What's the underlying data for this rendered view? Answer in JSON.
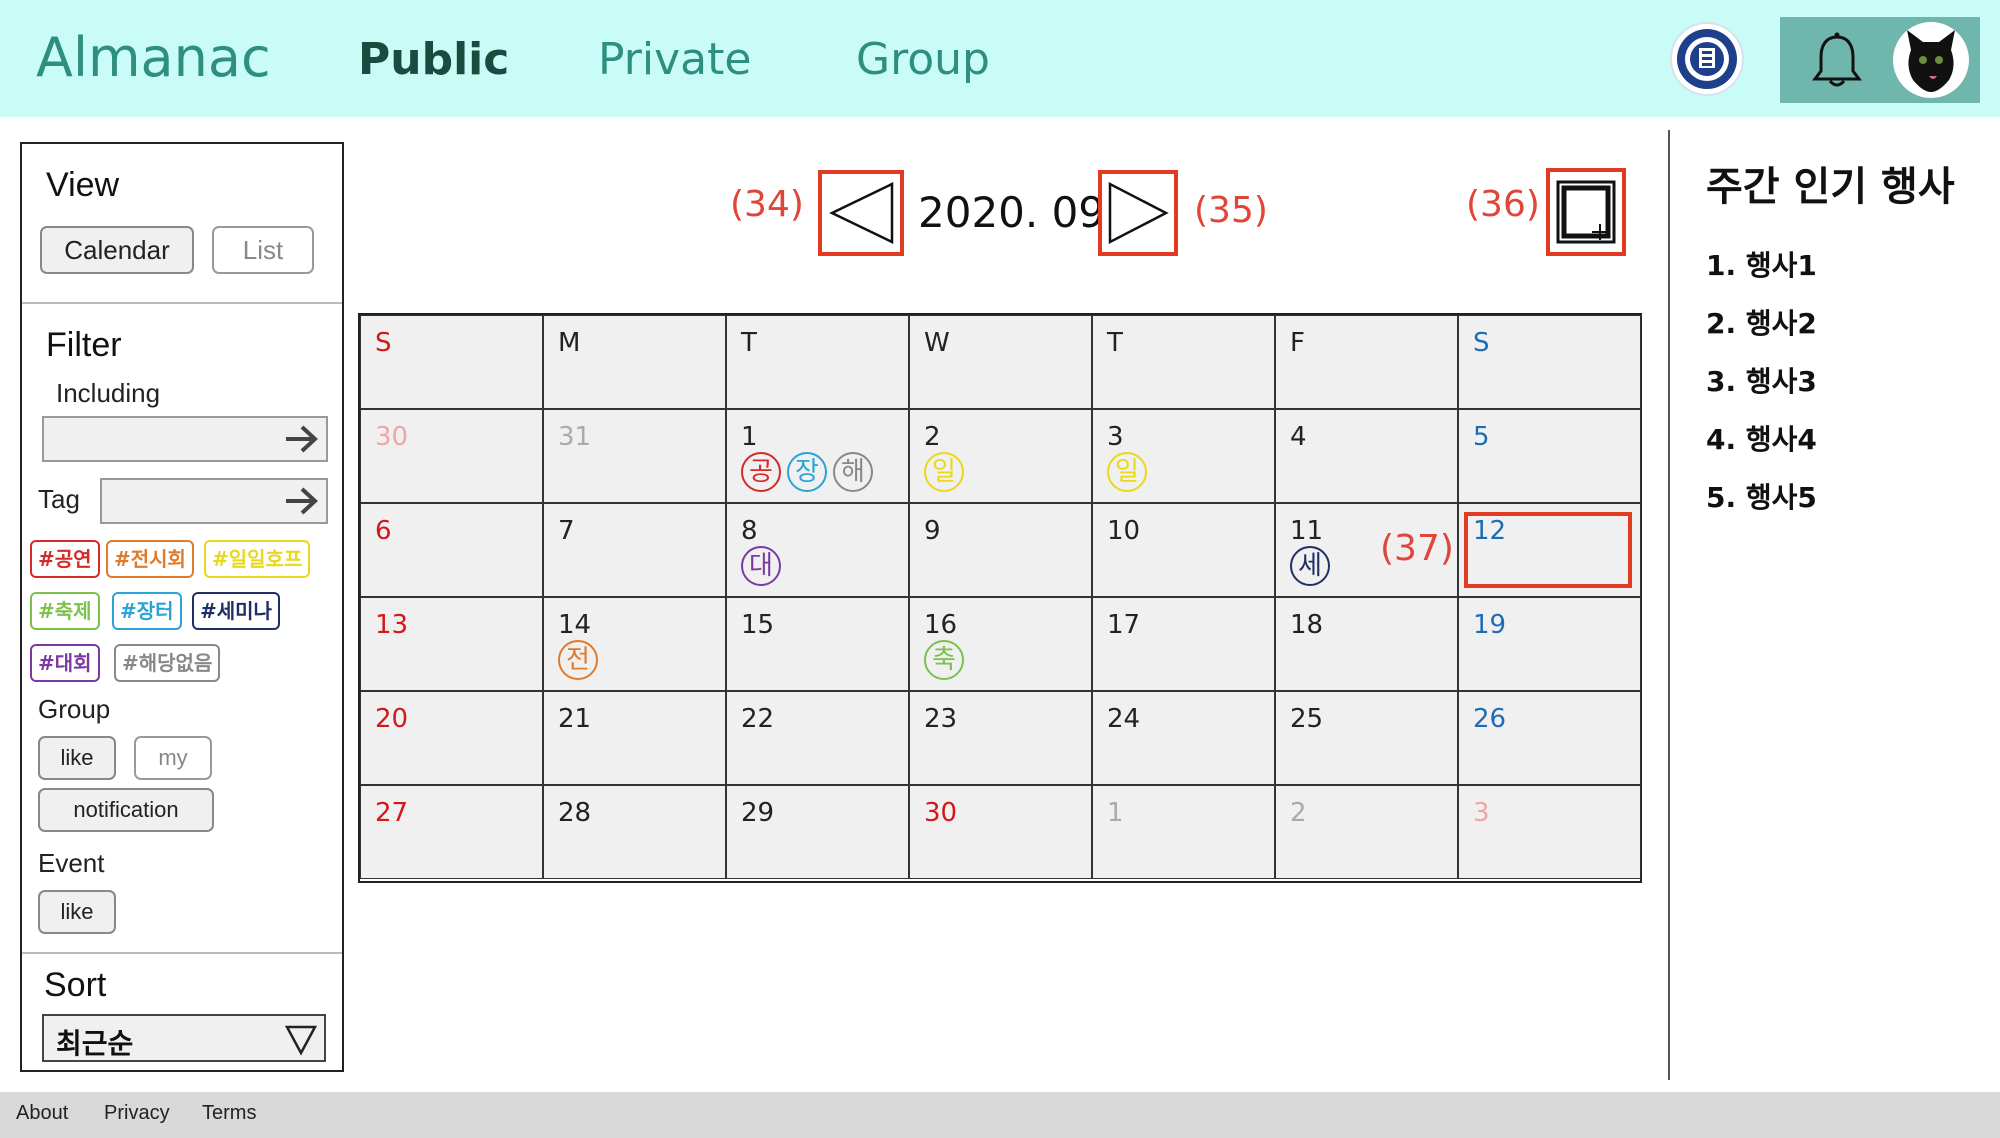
{
  "header": {
    "logo": "Almanac",
    "nav": [
      "Public",
      "Private",
      "Group"
    ],
    "active_nav": "Public"
  },
  "view": {
    "title": "View",
    "calendar_label": "Calendar",
    "list_label": "List"
  },
  "filter": {
    "title": "Filter",
    "including_label": "Including",
    "including_value": "",
    "tag_label": "Tag",
    "tag_value": "",
    "tags": [
      {
        "label": "#공연",
        "color": "#d42a2a"
      },
      {
        "label": "#전시회",
        "color": "#e07b2c"
      },
      {
        "label": "#일일호프",
        "color": "#e9d81c"
      },
      {
        "label": "#축제",
        "color": "#7dc04a"
      },
      {
        "label": "#장터",
        "color": "#2aa3d6"
      },
      {
        "label": "#세미나",
        "color": "#1f2f66"
      },
      {
        "label": "#대회",
        "color": "#7a3aa3"
      },
      {
        "label": "#해당없음",
        "color": "#888888"
      }
    ],
    "group_label": "Group",
    "group_like": "like",
    "group_my": "my",
    "group_notification": "notification",
    "event_label": "Event",
    "event_like": "like"
  },
  "sort": {
    "title": "Sort",
    "selected": "최근순"
  },
  "calendar": {
    "month_label": "2020. 09.",
    "annot_prev": "(34)",
    "annot_next": "(35)",
    "annot_add": "(36)",
    "annot_cell": "(37)",
    "weekdays": [
      "S",
      "M",
      "T",
      "W",
      "T",
      "F",
      "S"
    ],
    "weeks": [
      [
        {
          "d": "30",
          "dim": true,
          "badges": []
        },
        {
          "d": "31",
          "dim": true,
          "badges": []
        },
        {
          "d": "1",
          "badges": [
            {
              "t": "공",
              "c": "#d42a2a"
            },
            {
              "t": "장",
              "c": "#2aa3d6"
            },
            {
              "t": "해",
              "c": "#888888"
            }
          ]
        },
        {
          "d": "2",
          "badges": [
            {
              "t": "일",
              "c": "#e9d81c"
            }
          ]
        },
        {
          "d": "3",
          "badges": [
            {
              "t": "일",
              "c": "#e9d81c"
            }
          ]
        },
        {
          "d": "4",
          "badges": []
        },
        {
          "d": "5",
          "badges": []
        }
      ],
      [
        {
          "d": "6",
          "badges": []
        },
        {
          "d": "7",
          "badges": []
        },
        {
          "d": "8",
          "badges": [
            {
              "t": "대",
              "c": "#7a3aa3"
            }
          ]
        },
        {
          "d": "9",
          "badges": []
        },
        {
          "d": "10",
          "badges": []
        },
        {
          "d": "11",
          "badges": [
            {
              "t": "세",
              "c": "#1f2f66"
            }
          ]
        },
        {
          "d": "12",
          "badges": []
        }
      ],
      [
        {
          "d": "13",
          "badges": []
        },
        {
          "d": "14",
          "badges": [
            {
              "t": "전",
              "c": "#e07b2c"
            }
          ]
        },
        {
          "d": "15",
          "badges": []
        },
        {
          "d": "16",
          "badges": [
            {
              "t": "축",
              "c": "#7dc04a"
            }
          ]
        },
        {
          "d": "17",
          "badges": []
        },
        {
          "d": "18",
          "badges": []
        },
        {
          "d": "19",
          "badges": []
        }
      ],
      [
        {
          "d": "20",
          "badges": []
        },
        {
          "d": "21",
          "badges": []
        },
        {
          "d": "22",
          "badges": []
        },
        {
          "d": "23",
          "badges": []
        },
        {
          "d": "24",
          "badges": []
        },
        {
          "d": "25",
          "badges": []
        },
        {
          "d": "26",
          "badges": []
        }
      ],
      [
        {
          "d": "27",
          "badges": []
        },
        {
          "d": "28",
          "badges": []
        },
        {
          "d": "29",
          "badges": []
        },
        {
          "d": "30",
          "holiday": true,
          "badges": []
        },
        {
          "d": "1",
          "dim": true,
          "badges": []
        },
        {
          "d": "2",
          "dim": true,
          "badges": []
        },
        {
          "d": "3",
          "dim": true,
          "badges": []
        }
      ]
    ]
  },
  "popular": {
    "title": "주간 인기 행사",
    "items": [
      "1. 행사1",
      "2. 행사2",
      "3. 행사3",
      "4. 행사4",
      "5. 행사5"
    ]
  },
  "footer": {
    "links": [
      "About",
      "Privacy",
      "Terms"
    ]
  },
  "colors": {
    "header_bg": "#c9fcf6",
    "accent": "#2f8f7f",
    "annotation": "#e33b22",
    "sunday": "#d41818",
    "saturday": "#1e6cb5"
  },
  "icons": [
    "university-seal-icon",
    "bell-icon",
    "avatar-cat-icon",
    "arrow-right-icon",
    "triangle-left-icon",
    "triangle-right-icon",
    "add-event-icon",
    "dropdown-caret-icon"
  ]
}
